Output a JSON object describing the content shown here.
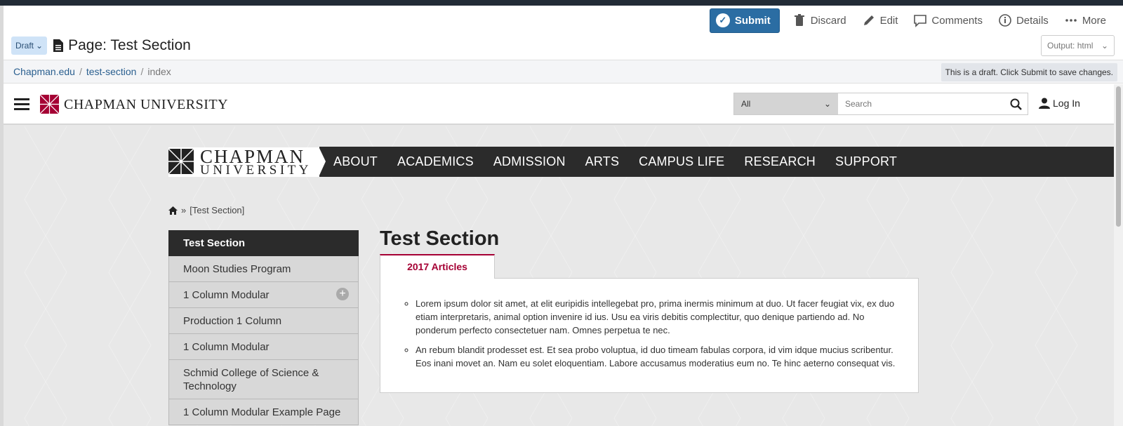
{
  "cms": {
    "actions": {
      "submit": "Submit",
      "discard": "Discard",
      "edit": "Edit",
      "comments": "Comments",
      "details": "Details",
      "more": "More"
    },
    "status": "Draft",
    "page_title": "Page: Test Section",
    "output_select": "Output: html",
    "breadcrumb": [
      "Chapman.edu",
      "test-section",
      "index"
    ],
    "draft_notice": "This is a draft. Click Submit to save changes."
  },
  "site": {
    "logo_text": "CHAPMAN UNIVERSITY",
    "search_scope": "All",
    "search_placeholder": "Search",
    "login": "Log In",
    "brand_line1": "CHAPMAN",
    "brand_line2": "UNIVERSITY",
    "nav": [
      "ABOUT",
      "ACADEMICS",
      "ADMISSION",
      "ARTS",
      "CAMPUS LIFE",
      "RESEARCH",
      "SUPPORT"
    ],
    "sub_breadcrumb": "[Test Section]",
    "sidenav": [
      "Test Section",
      "Moon Studies Program",
      "1 Column Modular",
      "Production 1 Column",
      "1 Column Modular",
      "Schmid College of Science & Technology",
      "1 Column Modular Example Page"
    ],
    "content_title": "Test Section",
    "tab_label": "2017 Articles",
    "articles": [
      "Lorem ipsum dolor sit amet, at elit euripidis intellegebat pro, prima inermis minimum at duo. Ut facer feugiat vix, ex duo etiam interpretaris, animal option invenire id ius. Usu ea viris debitis complectitur, quo denique partiendo ad. No ponderum perfecto consectetuer nam. Omnes perpetua te nec.",
      "An rebum blandit prodesset est. Et sea probo voluptua, id duo timeam fabulas corpora, id vim idque mucius scribentur. Eos inani movet an. Nam eu solet eloquentiam. Labore accusamus moderatius eum no. Te hinc aeterno consequat vis."
    ]
  },
  "colors": {
    "submit_blue": "#2b6da3",
    "brand_red": "#a50034",
    "nav_dark": "#2b2b2b"
  }
}
